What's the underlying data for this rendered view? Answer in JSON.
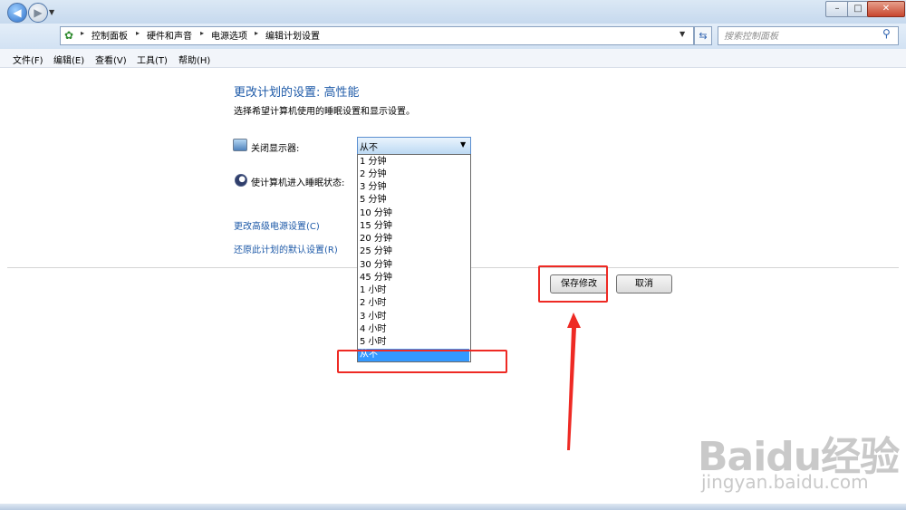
{
  "window": {
    "controls": {
      "minimize": "–",
      "maximize": "□",
      "close": "✕"
    }
  },
  "address_bar": {
    "breadcrumbs": [
      "控制面板",
      "硬件和声音",
      "电源选项",
      "编辑计划设置"
    ],
    "icons": {
      "back": "back-arrow-icon",
      "forward": "forward-arrow-icon",
      "refresh": "refresh-icon",
      "search": "search-icon",
      "control_panel": "control-panel-icon"
    }
  },
  "search": {
    "placeholder": "搜索控制面板"
  },
  "menubar": [
    "文件(F)",
    "编辑(E)",
    "查看(V)",
    "工具(T)",
    "帮助(H)"
  ],
  "content": {
    "title": "更改计划的设置: 高性能",
    "subtitle": "选择希望计算机使用的睡眠设置和显示设置。",
    "display_label": "关闭显示器:",
    "sleep_label": "使计算机进入睡眠状态:",
    "link_advanced": "更改高级电源设置(C)",
    "link_restore": "还原此计划的默认设置(R)"
  },
  "display_select": {
    "value": "从不",
    "options": [
      "1 分钟",
      "2 分钟",
      "3 分钟",
      "5 分钟",
      "10 分钟",
      "15 分钟",
      "20 分钟",
      "25 分钟",
      "30 分钟",
      "45 分钟",
      "1 小时",
      "2 小时",
      "3 小时",
      "4 小时",
      "5 小时",
      "从不"
    ],
    "selected_index": 15
  },
  "buttons": {
    "save": "保存修改",
    "cancel": "取消"
  },
  "annotation_color": "#ee2a24",
  "watermark": {
    "logo": "Baidu经验",
    "url": "jingyan.baidu.com"
  }
}
